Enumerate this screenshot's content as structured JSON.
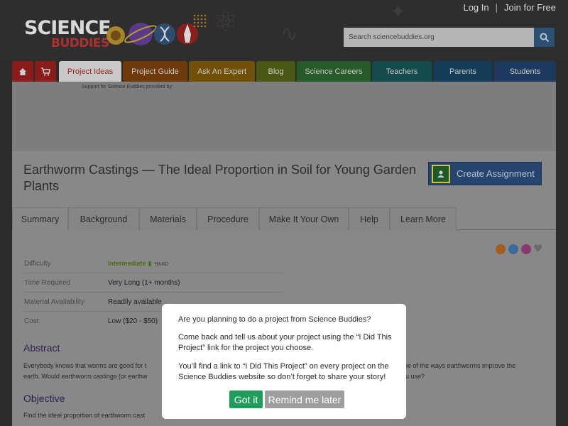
{
  "header": {
    "login": "Log In",
    "separator": "|",
    "join": "Join for Free",
    "logo_line1": "SCIENCE",
    "logo_line2": "BUDDIES",
    "search_placeholder": "Search sciencebuddies.org"
  },
  "nav": {
    "items": [
      {
        "label": "Project Ideas",
        "color": "#9a1f1f"
      },
      {
        "label": "Project Guide",
        "color": "#6e3a0c"
      },
      {
        "label": "Ask An Expert",
        "color": "#70510a"
      },
      {
        "label": "Blog",
        "color": "#4b5714"
      },
      {
        "label": "Science Careers",
        "color": "#285928"
      },
      {
        "label": "Teachers",
        "color": "#154a4d"
      },
      {
        "label": "Parents",
        "color": "#153c57"
      },
      {
        "label": "Students",
        "color": "#1d3a5e"
      }
    ]
  },
  "ad_label": "Support for Science Buddies provided by:",
  "page": {
    "title": "Earthworm Castings — The Ideal Proportion in Soil for Young Garden Plants",
    "create_assignment": "Create Assignment"
  },
  "tabs": [
    "Summary",
    "Background",
    "Materials",
    "Procedure",
    "Make It Your Own",
    "Help",
    "Learn More"
  ],
  "summary": {
    "difficulty_label": "Difficulty",
    "difficulty_value": "Intermediate",
    "difficulty_hard": "HARD",
    "time_label": "Time Required",
    "time_value": "Very Long (1+ months)",
    "material_label": "Material Availability",
    "material_value": "Readily available",
    "cost_label": "Cost",
    "cost_value": "Low ($20 - $50)"
  },
  "abstract": {
    "heading": "Abstract",
    "text_left": "Everybody knows that worms are good for t",
    "text_right": "one of the ways earthworms improve the",
    "text2_left": "earth. Would earthworm castings (or earthw",
    "text2_right": "u use?"
  },
  "objective": {
    "heading": "Objective",
    "text": "Find the ideal proportion of earthworm cast"
  },
  "modal": {
    "line1": "Are you planning to do a project from Science Buddies?",
    "line2": "Come back and tell us about your project using the “I Did This Project” link for the project you choose.",
    "line3": "You’ll find a link to “I Did This Project” on every project on the Science Buddies website so don’t forget to share your story!",
    "got_it": "Got it",
    "remind": "Remind me later",
    "got_it_color": "#1e9e5a",
    "remind_color": "#9e9e9e"
  }
}
